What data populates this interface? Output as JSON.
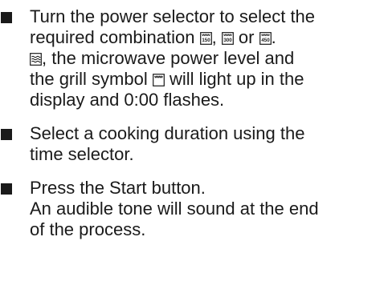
{
  "steps": [
    {
      "line1": "Turn the power selector to select the",
      "line2_pre": "required combination ",
      "combo_1": "150",
      "sep_1": ", ",
      "combo_2": "300",
      "sep_2": " or ",
      "combo_3": "450",
      "line2_end": ".",
      "line3_post": ", the microwave power level and",
      "line4_pre": "the grill symbol ",
      "line4_post": " will light up in the",
      "line5": "display and 0:00 flashes."
    },
    {
      "line1": "Select a cooking duration using the",
      "line2": "time selector."
    },
    {
      "line1": "Press the Start button.",
      "line2": "An audible tone will sound at the end",
      "line3": "of the process."
    }
  ],
  "icons": {
    "combo": "grill-microwave-combination-icon",
    "microwave": "microwave-waves-icon",
    "grill": "grill-symbol-icon"
  }
}
